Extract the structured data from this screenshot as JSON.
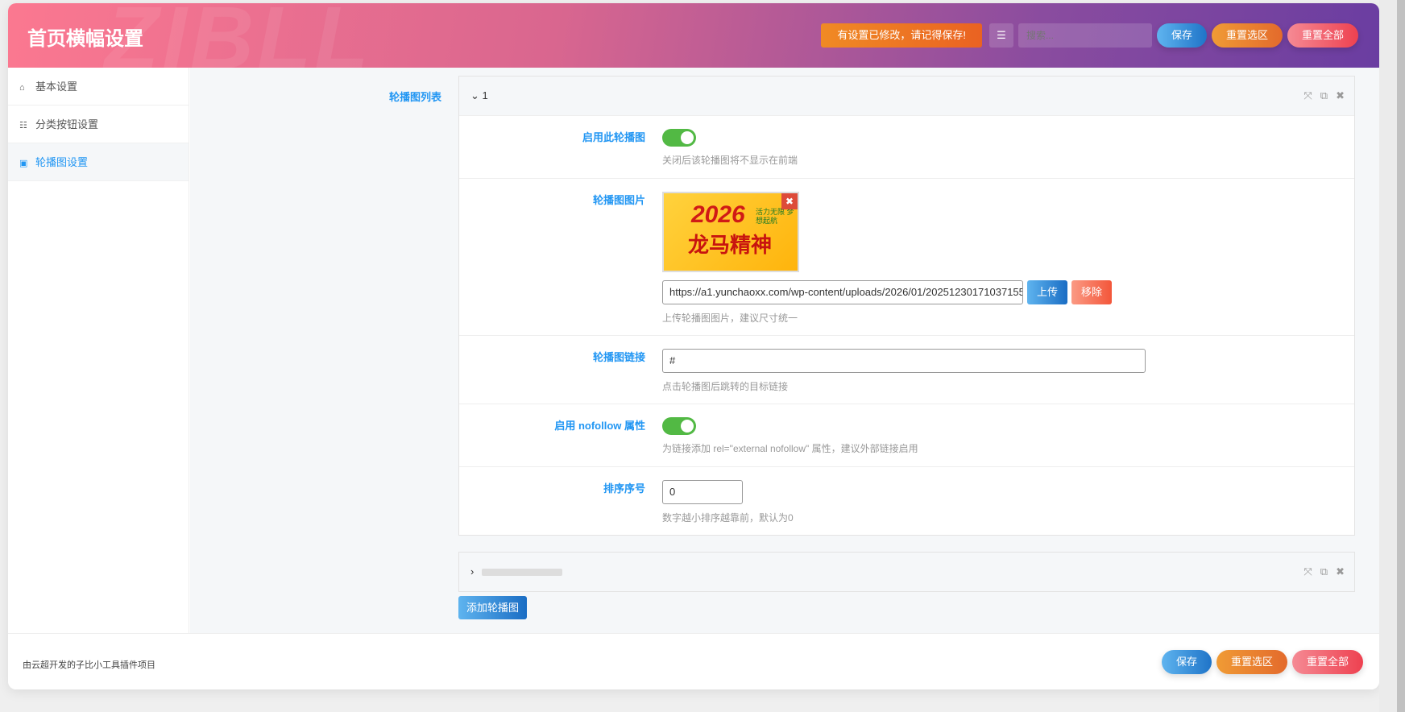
{
  "header": {
    "title": "首页横幅设置",
    "watermark": "ZIBLL",
    "notice": "有设置已修改，请记得保存!",
    "search_placeholder": "搜索...",
    "save": "保存",
    "reset_section": "重置选区",
    "reset_all": "重置全部"
  },
  "sidebar": {
    "items": [
      {
        "label": "基本设置",
        "icon": "home-icon"
      },
      {
        "label": "分类按钮设置",
        "icon": "list-icon"
      },
      {
        "label": "轮播图设置",
        "icon": "image-icon",
        "active": true
      }
    ]
  },
  "main": {
    "section_label": "轮播图列表",
    "slides": [
      {
        "title": "1",
        "expanded": true,
        "fields": {
          "enable": {
            "label": "启用此轮播图",
            "on": true,
            "desc": "关闭后该轮播图将不显示在前端"
          },
          "image": {
            "label": "轮播图图片",
            "thumb_text1": "2026",
            "thumb_text2": "龙马精神",
            "thumb_text3": "活力无限 梦想起航",
            "url": "https://a1.yunchaoxx.com/wp-content/uploads/2026/01/20251230171037155",
            "upload": "上传",
            "remove": "移除",
            "desc": "上传轮播图图片，建议尺寸统一"
          },
          "link": {
            "label": "轮播图链接",
            "value": "#",
            "desc": "点击轮播图后跳转的目标链接"
          },
          "nofollow": {
            "label": "启用 nofollow 属性",
            "on": true,
            "desc": "为链接添加 rel=\"external nofollow\" 属性，建议外部链接启用"
          },
          "order": {
            "label": "排序序号",
            "value": "0",
            "desc": "数字越小排序越靠前，默认为0"
          }
        }
      },
      {
        "title": "",
        "expanded": false
      }
    ],
    "add_button": "添加轮播图"
  },
  "footer": {
    "text": "由云超开发的子比小工具插件项目",
    "save": "保存",
    "reset_section": "重置选区",
    "reset_all": "重置全部"
  },
  "colors": {
    "accent": "#2196f3",
    "toggle_on": "#52b944"
  }
}
